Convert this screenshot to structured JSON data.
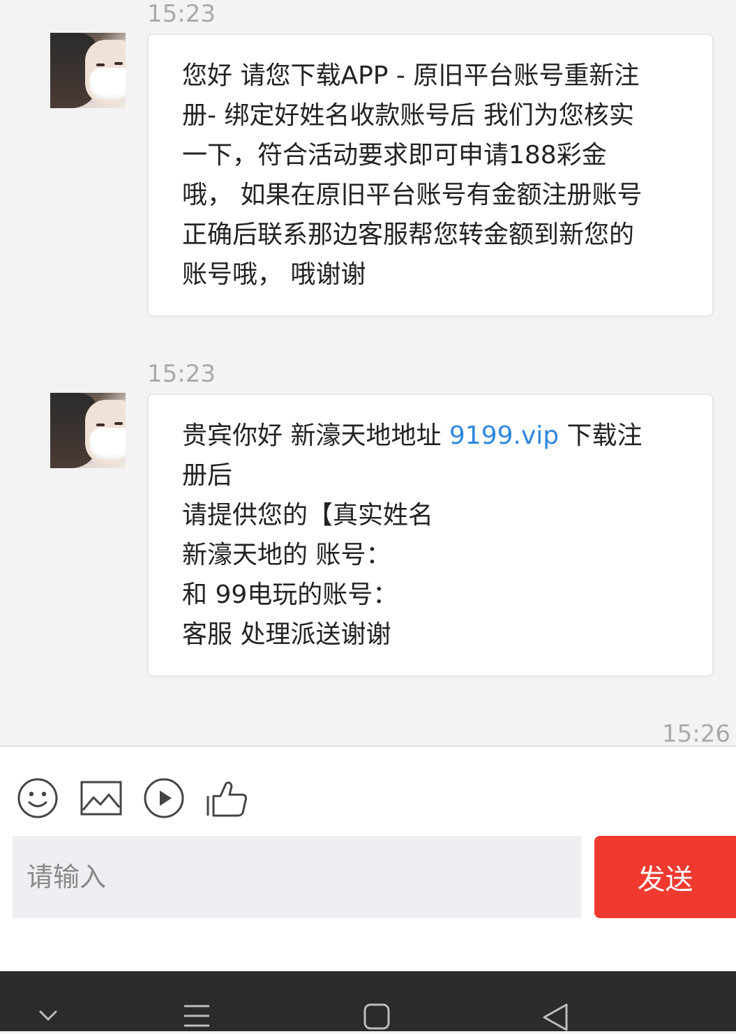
{
  "messages": [
    {
      "time": "15:23",
      "lines": [
        "您好 请您下载APP - 原旧平台账号重新注",
        "册- 绑定好姓名收款账号后 我们为您核实",
        "一下，符合活动要求即可申请188彩金",
        "哦， 如果在原旧平台账号有金额注册账号",
        "正确后联系那边客服帮您转金额到新您的",
        "账号哦， 哦谢谢"
      ]
    },
    {
      "time": "15:23",
      "line1_before": "贵宾你好 新濠天地地址 ",
      "line1_link": "9199.vip",
      "line1_after": " 下载注",
      "lines": [
        "册后",
        "请提供您的【真实姓名",
        "新濠天地的 账号：",
        "和 99电玩的账号：",
        "客服 处理派送谢谢"
      ]
    }
  ],
  "last_time": "15:26",
  "toolbar": {
    "icons": [
      "emoji-icon",
      "image-icon",
      "video-icon",
      "thumbs-up-icon"
    ]
  },
  "composer": {
    "placeholder": "请输入",
    "send_label": "发送"
  },
  "colors": {
    "send": "#f03a30",
    "link": "#2e86de"
  }
}
